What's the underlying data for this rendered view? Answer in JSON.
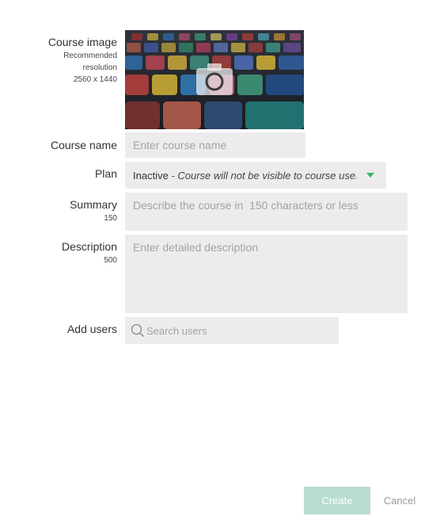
{
  "form": {
    "course_image": {
      "label": "Course image",
      "hint_line1": "Recommended",
      "hint_line2": "resolution",
      "hint_line3": "2560 x 1440",
      "icon": "camera-icon"
    },
    "course_name": {
      "label": "Course name",
      "placeholder": "Enter course name"
    },
    "plan": {
      "label": "Plan",
      "selected": "Inactive",
      "selected_description": "- Course will not be visible to course users",
      "accent_color": "#3cb371"
    },
    "summary": {
      "label": "Summary",
      "limit": "150",
      "placeholder": "Describe the course in  150 characters or less"
    },
    "description": {
      "label": "Description",
      "limit": "500",
      "placeholder": "Enter detailed description"
    },
    "add_users": {
      "label": "Add users",
      "placeholder": "Search users",
      "icon": "search-icon"
    }
  },
  "actions": {
    "create_label": "Create",
    "cancel_label": "Cancel",
    "create_color": "#b9dcd2"
  }
}
